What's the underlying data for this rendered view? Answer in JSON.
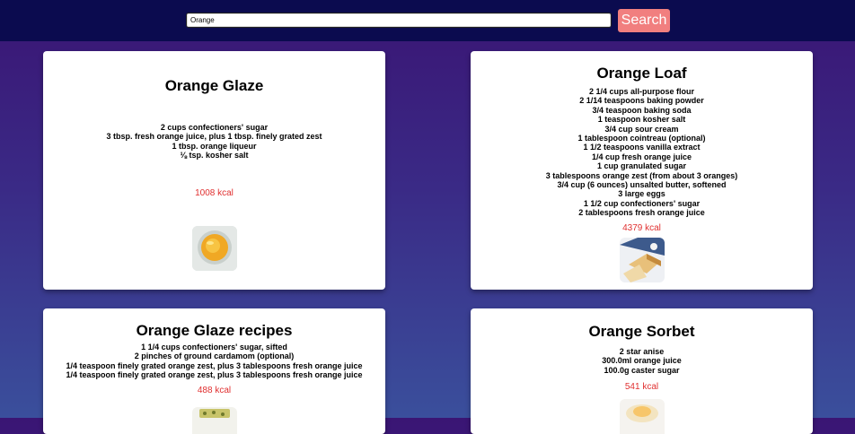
{
  "search": {
    "value": "Orange",
    "button_label": "Search"
  },
  "recipes": [
    {
      "title": "Orange Glaze",
      "ingredients": [
        "2 cups confectioners' sugar",
        "3 tbsp. fresh orange juice, plus 1 tbsp. finely grated zest",
        "1 tbsp. orange liqueur",
        "⅛ tsp. kosher salt"
      ],
      "kcal": "1008 kcal",
      "image_icon": "orange-glaze-photo-icon"
    },
    {
      "title": "Orange Loaf",
      "ingredients": [
        "2 1/4 cups all-purpose flour",
        "2 1/14 teaspoons baking powder",
        "3/4 teaspoon baking soda",
        "1 teaspoon kosher salt",
        "3/4 cup sour cream",
        "1 tablespoon cointreau (optional)",
        "1 1/2 teaspoons vanilla extract",
        "1/4 cup fresh orange juice",
        "1 cup granulated sugar",
        "3 tablespoons orange zest (from about 3 oranges)",
        "3/4 cup (6 ounces) unsalted butter, softened",
        "3 large eggs",
        "1 1/2 cup confectioners' sugar",
        "2 tablespoons fresh orange juice"
      ],
      "kcal": "4379 kcal",
      "image_icon": "orange-loaf-photo-icon"
    },
    {
      "title": "Orange Glaze recipes",
      "ingredients": [
        "1 1/4 cups confectioners' sugar, sifted",
        "2 pinches of ground cardamom (optional)",
        "1/4 teaspoon finely grated orange zest, plus 3 tablespoons fresh orange juice",
        "1/4 teaspoon finely grated orange zest, plus 3 tablespoons fresh orange juice"
      ],
      "kcal": "488 kcal",
      "image_icon": "orange-glaze-recipes-photo-icon"
    },
    {
      "title": "Orange Sorbet",
      "ingredients": [
        "2 star anise",
        "300.0ml orange juice",
        "100.0g caster sugar"
      ],
      "kcal": "541 kcal",
      "image_icon": "orange-sorbet-photo-icon"
    }
  ]
}
